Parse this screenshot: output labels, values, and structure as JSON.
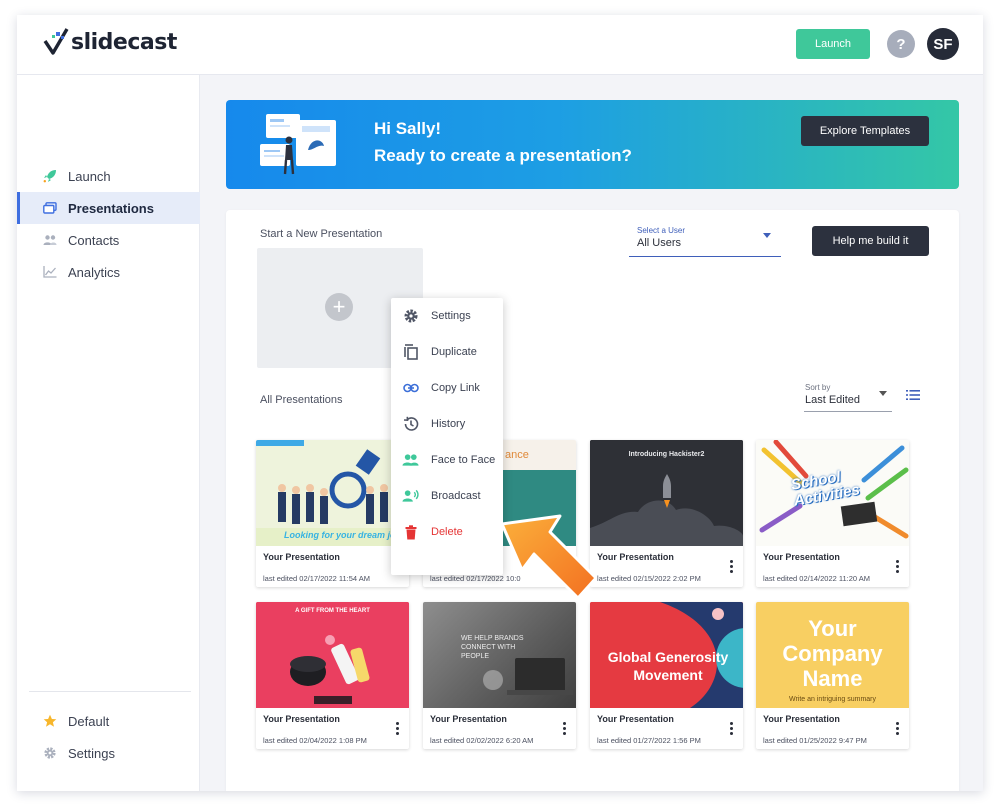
{
  "app": {
    "logo_text": "slidecast"
  },
  "header": {
    "launch_label": "Launch",
    "help_label": "?",
    "avatar_initials": "SF"
  },
  "sidebar": {
    "items": [
      {
        "label": "Launch",
        "icon": "rocket-icon"
      },
      {
        "label": "Presentations",
        "icon": "presentations-icon",
        "active": true
      },
      {
        "label": "Contacts",
        "icon": "contacts-icon"
      },
      {
        "label": "Analytics",
        "icon": "analytics-icon"
      }
    ],
    "bottom": [
      {
        "label": "Default",
        "icon": "star-icon"
      },
      {
        "label": "Settings",
        "icon": "gear-icon"
      }
    ]
  },
  "banner": {
    "greeting": "Hi Sally!",
    "subtitle": "Ready to create a presentation?",
    "explore_label": "Explore Templates"
  },
  "main": {
    "start_label": "Start a New Presentation",
    "user_select": {
      "label": "Select a User",
      "value": "All Users"
    },
    "help_build_label": "Help me build it",
    "all_label": "All Presentations",
    "sort": {
      "label": "Sort by",
      "value": "Last Edited"
    }
  },
  "context_menu": [
    {
      "label": "Settings",
      "icon": "gear-icon"
    },
    {
      "label": "Duplicate",
      "icon": "duplicate-icon"
    },
    {
      "label": "Copy Link",
      "icon": "link-icon"
    },
    {
      "label": "History",
      "icon": "history-icon"
    },
    {
      "label": "Face to Face",
      "icon": "face-to-face-icon"
    },
    {
      "label": "Broadcast",
      "icon": "broadcast-icon"
    },
    {
      "label": "Delete",
      "icon": "trash-icon",
      "danger": true
    }
  ],
  "presentations": [
    {
      "name": "Your Presentation",
      "date": "last edited 02/17/2022 11:54 AM",
      "caption": "Looking for your dream job?"
    },
    {
      "name": "",
      "date": "last edited 02/17/2022 10:0",
      "caption": "ance"
    },
    {
      "name": "Your Presentation",
      "date": "last edited 02/15/2022 2:02 PM",
      "caption": "Introducing Hackister2"
    },
    {
      "name": "Your Presentation",
      "date": "last edited 02/14/2022 11:20 AM",
      "caption": "School Activities"
    },
    {
      "name": "Your Presentation",
      "date": "last edited 02/04/2022 1:08 PM",
      "caption": "A GIFT FROM THE HEART"
    },
    {
      "name": "Your Presentation",
      "date": "last edited 02/02/2022 6:20 AM",
      "caption": "WE HELP BRANDS CONNECT WITH PEOPLE"
    },
    {
      "name": "Your Presentation",
      "date": "last edited 01/27/2022 1:56 PM",
      "caption": "Global Generosity Movement"
    },
    {
      "name": "Your Presentation",
      "date": "last edited 01/25/2022 9:47 PM",
      "caption": "Your Company Name",
      "sub": "Write an intriguing summary"
    }
  ],
  "colors": {
    "accent": "#3fc89a",
    "dark_button": "#2c313e",
    "active_nav": "#3f6fe0",
    "danger": "#e53535",
    "arrow": "#f7911e"
  }
}
